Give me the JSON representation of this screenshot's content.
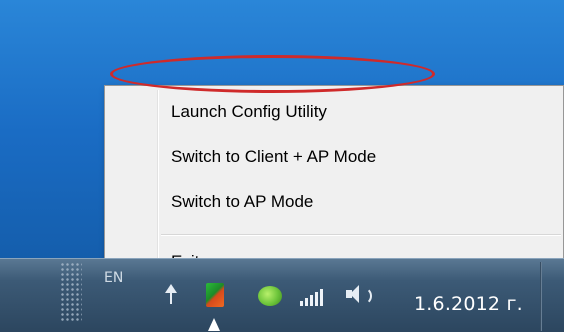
{
  "menu": {
    "items": [
      {
        "label": "Launch Config Utility"
      },
      {
        "label": "Switch to Client + AP Mode"
      },
      {
        "label": "Switch to AP Mode"
      },
      {
        "label": "Exit"
      }
    ]
  },
  "taskbar": {
    "language": "EN",
    "clock": "1.6.2012 г."
  },
  "tray_icons": [
    "action-center-flag-icon",
    "n-app-icon",
    "green-app-icon",
    "wifi-signal-icon",
    "volume-icon"
  ],
  "colors": {
    "highlight": "#cf2a2a",
    "desktop": "#1a6cc4",
    "menu_bg": "#f0f0f0"
  }
}
